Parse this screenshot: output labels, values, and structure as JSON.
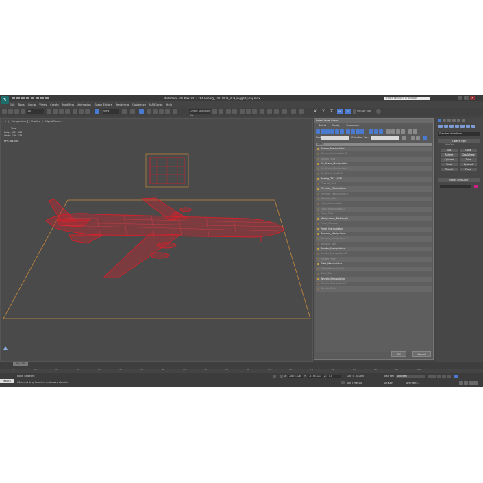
{
  "app": {
    "title": "Autodesk 3ds Max  2012 x64    Boeing_747-100B_RLH_Rigged_vray.max",
    "search_placeholder": "Type a keyword or phrase",
    "logo": "3"
  },
  "menu": [
    "Edit",
    "Tools",
    "Group",
    "Views",
    "Create",
    "Modifiers",
    "Animation",
    "Graph Editors",
    "Rendering",
    "Customize",
    "MAXScript",
    "Help"
  ],
  "toolbar": {
    "filter_all": "All",
    "view_dropdown": "View",
    "selection_set": "Create Selection Se",
    "axis_labels": [
      "X",
      "Y",
      "Z",
      "XY",
      "XY"
    ],
    "objtool": "ify Curr Tool"
  },
  "viewport": {
    "label": "[ + ] [ Perspective ] [ Shaded + Edged Faces ]",
    "stats": {
      "total_label": "Total",
      "polys_label": "Polys:",
      "polys_value": "489 660",
      "verts_label": "Verts:",
      "verts_value": "206 232",
      "fps_label": "FPS:",
      "fps_value": "46.550"
    }
  },
  "dialog": {
    "title": "Select From Scene",
    "menu": [
      "Select",
      "Display",
      "Customize"
    ],
    "find_label": "Find:",
    "selection_set_label": "Selection Set:",
    "column_header": "Name",
    "items": [
      {
        "name": "Aileron_Manipulator",
        "style": "bright"
      },
      {
        "name": "Aileron_Manipulator 2",
        "style": "dim"
      },
      {
        "name": "Aileron_Text",
        "style": "dim"
      },
      {
        "name": "Air_Brake_Manipulator",
        "style": "bright"
      },
      {
        "name": "Air_Brake_Manipulator 2",
        "style": "dim"
      },
      {
        "name": "Air_Brake_Text001",
        "style": "dim"
      },
      {
        "name": "Boeing_747-100B",
        "style": "bright"
      },
      {
        "name": "Chassis_Text",
        "style": "dim"
      },
      {
        "name": "Elevator_Manipulator",
        "style": "bright"
      },
      {
        "name": "Elevator_Manipulator 2",
        "style": "dim"
      },
      {
        "name": "Elevator_Text",
        "style": "dim"
      },
      {
        "name": "Flaps_Manipulator",
        "style": "dim"
      },
      {
        "name": "Flaps_Manipulator 2",
        "style": "dim"
      },
      {
        "name": "Flaps_Text",
        "style": "dim"
      },
      {
        "name": "Manipulator_Rectangle",
        "style": "bright"
      },
      {
        "name": "Panel_Chassis",
        "style": "dim"
      },
      {
        "name": "Panel_Manipulator",
        "style": "bright"
      },
      {
        "name": "Remove_Manipulator",
        "style": "bright"
      },
      {
        "name": "Remove_Manipulator 2",
        "style": "dim"
      },
      {
        "name": "Remove_Text",
        "style": "dim"
      },
      {
        "name": "Rudder_Manipulator",
        "style": "bright"
      },
      {
        "name": "Rudder_Manipulator 2",
        "style": "dim"
      },
      {
        "name": "Rudder_Text",
        "style": "dim"
      },
      {
        "name": "Slats_Manipulator",
        "style": "bright"
      },
      {
        "name": "Slats_Manipulator 2",
        "style": "dim"
      },
      {
        "name": "Slats_Text",
        "style": "dim"
      },
      {
        "name": "Wheels_Manipulator",
        "style": "bright"
      },
      {
        "name": "Wheels_Manipulator 2",
        "style": "dim"
      },
      {
        "name": "Wheels_Text",
        "style": "dim"
      }
    ],
    "ok": "OK",
    "cancel": "Cancel"
  },
  "command_panel": {
    "dropdown": "Standard Primitives",
    "object_type": "Object Type",
    "autogrid": "AutoGrid",
    "objects": [
      "Box",
      "Cone",
      "Sphere",
      "GeoSphere",
      "Cylinder",
      "Tube",
      "Torus",
      "Pyramid",
      "Teapot",
      "Plane"
    ],
    "name_and_color": "Name and Color"
  },
  "timeline": {
    "slider": "0 / 100",
    "ticks": [
      "0",
      "10",
      "15",
      "20",
      "25",
      "30",
      "35",
      "40",
      "45",
      "50",
      "55",
      "60",
      "65",
      "70",
      "75",
      "80",
      "85",
      "90",
      "95",
      "100"
    ]
  },
  "status": {
    "maxscript": "Max to",
    "none_selected": "None Selected",
    "prompt": "Click and drag to select and move objects",
    "x_label": "X:",
    "x_value": "-1875.326",
    "y_label": "Y:",
    "y_value": "-6738.321",
    "z_label": "Z:",
    "z_value": "0.0",
    "grid": "Grid = 10.0cm",
    "autokey": "Auto Key",
    "selected": "Selected",
    "set_key": "Set Key",
    "key_filters": "Key Filters...",
    "add_time_tag": "Add Time Tag"
  },
  "colors": {
    "wireframe": "#d8202a",
    "bbox": "#c98a3a",
    "viewport_bg": "#4a4a4a",
    "selected_blue": "#4b7bd0"
  }
}
